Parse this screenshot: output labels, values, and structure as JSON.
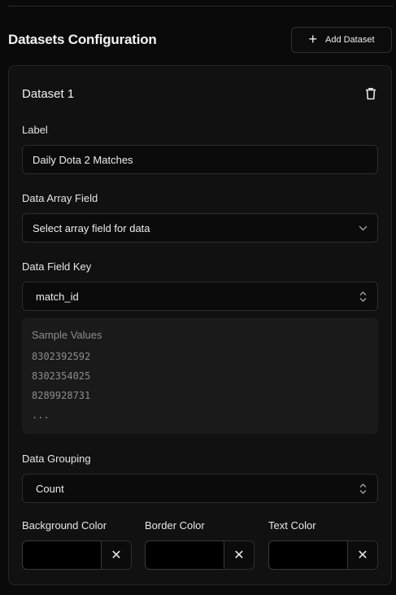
{
  "header": {
    "title": "Datasets Configuration",
    "add_button_label": "Add Dataset"
  },
  "dataset": {
    "title": "Dataset 1",
    "label_field": {
      "label": "Label",
      "value": "Daily Dota 2 Matches"
    },
    "array_field": {
      "label": "Data Array Field",
      "value": "Select array field for data"
    },
    "key_field": {
      "label": "Data Field Key",
      "value": "match_id"
    },
    "samples": {
      "title": "Sample Values",
      "values": [
        "8302392592",
        "8302354025",
        "8289928731",
        "..."
      ]
    },
    "grouping": {
      "label": "Data Grouping",
      "value": "Count"
    },
    "colors": [
      {
        "label": "Background Color",
        "value": "#000000"
      },
      {
        "label": "Border Color",
        "value": "#000000"
      },
      {
        "label": "Text Color",
        "value": "#000000"
      }
    ]
  },
  "icons": {
    "add": "plus-icon",
    "delete": "trash-icon",
    "dropdown": "chevron-down-icon",
    "sort": "chevron-up-down-icon",
    "clear": "close-icon"
  }
}
